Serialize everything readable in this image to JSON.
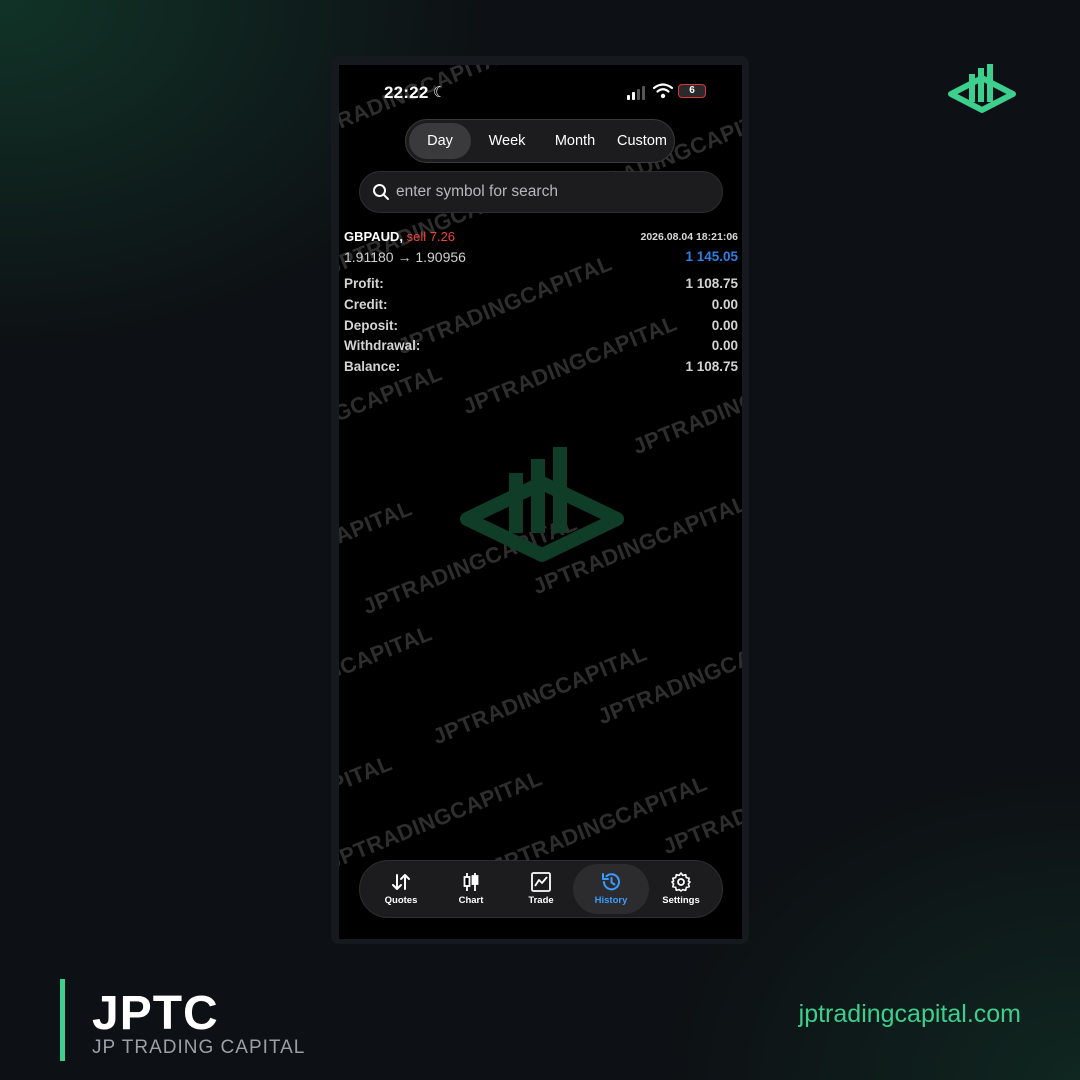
{
  "brand": {
    "title": "JPTC",
    "subtitle": "JP TRADING CAPITAL",
    "website": "jptradingcapital.com",
    "watermark_text": "JPTRADINGCAPITAL",
    "accent_color": "#3ccf8e",
    "logo_icon": "bar-chart-diamond-logo"
  },
  "status_bar": {
    "time": "22:22",
    "battery": "6",
    "icons": [
      "moon-icon",
      "signal-icon",
      "wifi-icon",
      "battery-icon"
    ]
  },
  "period_tabs": {
    "items": [
      "Day",
      "Week",
      "Month",
      "Custom"
    ],
    "selected": "Day"
  },
  "search": {
    "placeholder": "enter symbol for search"
  },
  "deal": {
    "symbol": "GBPAUD,",
    "direction": "sell 7.26",
    "datetime": "2026.08.04 18:21:06",
    "prices": "1.91180 → 1.90956",
    "profit": "1 145.05",
    "direction_color": "#f04438",
    "profit_color": "#2f7fe0"
  },
  "summary": [
    {
      "label": "Profit:",
      "value": "1 108.75"
    },
    {
      "label": "Credit:",
      "value": "0.00"
    },
    {
      "label": "Deposit:",
      "value": "0.00"
    },
    {
      "label": "Withdrawal:",
      "value": "0.00"
    },
    {
      "label": "Balance:",
      "value": "1 108.75"
    }
  ],
  "tabbar": {
    "items": [
      {
        "label": "Quotes",
        "icon": "quotes-icon"
      },
      {
        "label": "Chart",
        "icon": "candlestick-icon"
      },
      {
        "label": "Trade",
        "icon": "trade-chart-icon"
      },
      {
        "label": "History",
        "icon": "history-icon"
      },
      {
        "label": "Settings",
        "icon": "settings-icon"
      }
    ],
    "selected": "History",
    "active_color": "#3a9cff"
  }
}
